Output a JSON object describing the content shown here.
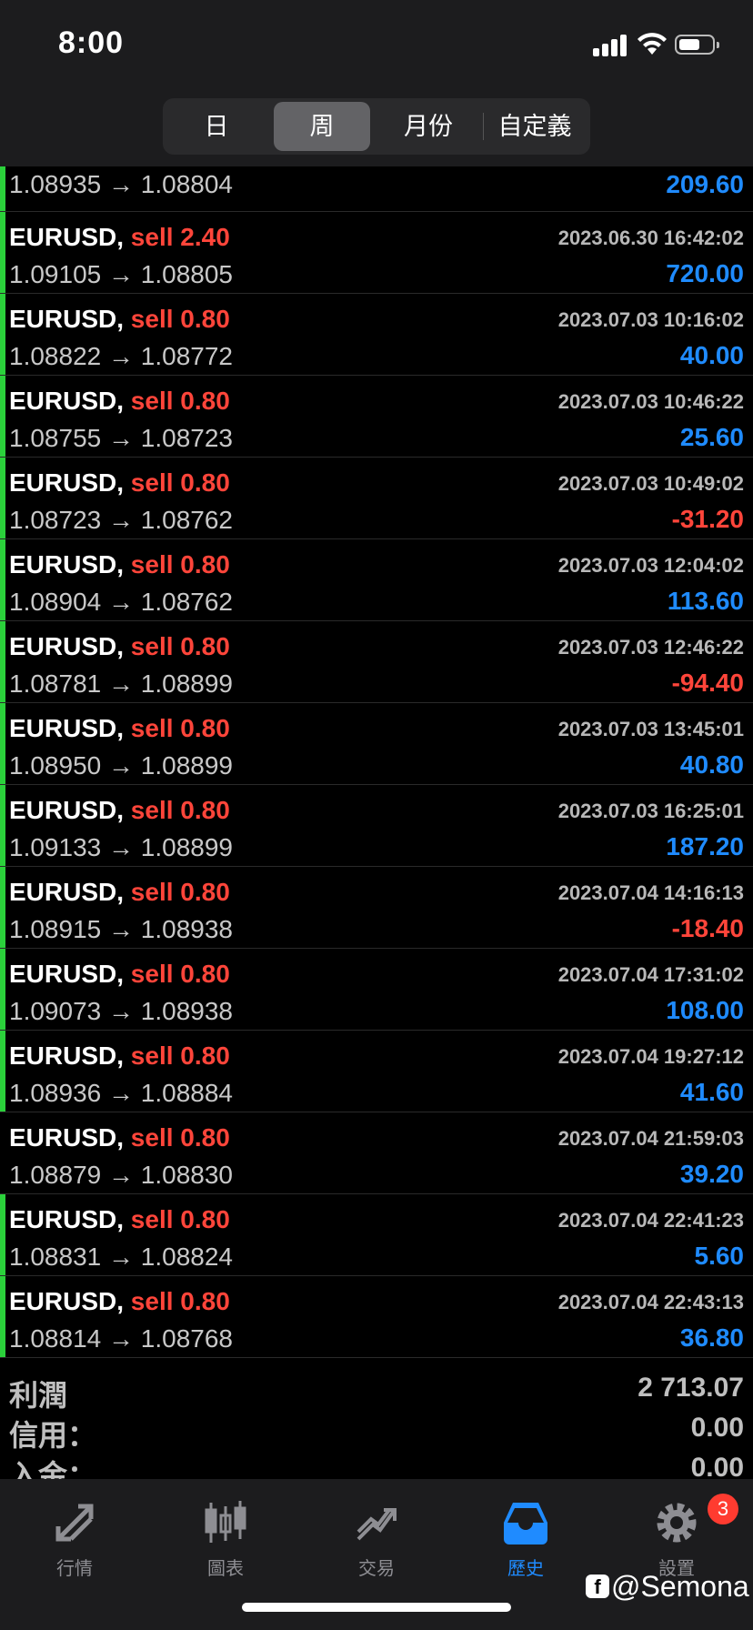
{
  "status": {
    "time": "8:00"
  },
  "segments": [
    "日",
    "周",
    "月份",
    "自定義"
  ],
  "segments_active": "周",
  "partial_row": {
    "price_open": "1.08935",
    "price_close": "1.08804",
    "profit": "209.60"
  },
  "rows": [
    {
      "symbol": "EURUSD",
      "side": "sell",
      "volume": "2.40",
      "datetime": "2023.06.30 16:42:02",
      "price_open": "1.09105",
      "price_close": "1.08805",
      "profit": "720.00",
      "bar": true
    },
    {
      "symbol": "EURUSD",
      "side": "sell",
      "volume": "0.80",
      "datetime": "2023.07.03 10:16:02",
      "price_open": "1.08822",
      "price_close": "1.08772",
      "profit": "40.00",
      "bar": true
    },
    {
      "symbol": "EURUSD",
      "side": "sell",
      "volume": "0.80",
      "datetime": "2023.07.03 10:46:22",
      "price_open": "1.08755",
      "price_close": "1.08723",
      "profit": "25.60",
      "bar": true
    },
    {
      "symbol": "EURUSD",
      "side": "sell",
      "volume": "0.80",
      "datetime": "2023.07.03 10:49:02",
      "price_open": "1.08723",
      "price_close": "1.08762",
      "profit": "-31.20",
      "bar": true
    },
    {
      "symbol": "EURUSD",
      "side": "sell",
      "volume": "0.80",
      "datetime": "2023.07.03 12:04:02",
      "price_open": "1.08904",
      "price_close": "1.08762",
      "profit": "113.60",
      "bar": true
    },
    {
      "symbol": "EURUSD",
      "side": "sell",
      "volume": "0.80",
      "datetime": "2023.07.03 12:46:22",
      "price_open": "1.08781",
      "price_close": "1.08899",
      "profit": "-94.40",
      "bar": true
    },
    {
      "symbol": "EURUSD",
      "side": "sell",
      "volume": "0.80",
      "datetime": "2023.07.03 13:45:01",
      "price_open": "1.08950",
      "price_close": "1.08899",
      "profit": "40.80",
      "bar": true
    },
    {
      "symbol": "EURUSD",
      "side": "sell",
      "volume": "0.80",
      "datetime": "2023.07.03 16:25:01",
      "price_open": "1.09133",
      "price_close": "1.08899",
      "profit": "187.20",
      "bar": true
    },
    {
      "symbol": "EURUSD",
      "side": "sell",
      "volume": "0.80",
      "datetime": "2023.07.04 14:16:13",
      "price_open": "1.08915",
      "price_close": "1.08938",
      "profit": "-18.40",
      "bar": true
    },
    {
      "symbol": "EURUSD",
      "side": "sell",
      "volume": "0.80",
      "datetime": "2023.07.04 17:31:02",
      "price_open": "1.09073",
      "price_close": "1.08938",
      "profit": "108.00",
      "bar": true
    },
    {
      "symbol": "EURUSD",
      "side": "sell",
      "volume": "0.80",
      "datetime": "2023.07.04 19:27:12",
      "price_open": "1.08936",
      "price_close": "1.08884",
      "profit": "41.60",
      "bar": true
    },
    {
      "symbol": "EURUSD",
      "side": "sell",
      "volume": "0.80",
      "datetime": "2023.07.04 21:59:03",
      "price_open": "1.08879",
      "price_close": "1.08830",
      "profit": "39.20",
      "bar": false
    },
    {
      "symbol": "EURUSD",
      "side": "sell",
      "volume": "0.80",
      "datetime": "2023.07.04 22:41:23",
      "price_open": "1.08831",
      "price_close": "1.08824",
      "profit": "5.60",
      "bar": true
    },
    {
      "symbol": "EURUSD",
      "side": "sell",
      "volume": "0.80",
      "datetime": "2023.07.04 22:43:13",
      "price_open": "1.08814",
      "price_close": "1.08768",
      "profit": "36.80",
      "bar": true
    }
  ],
  "summary": {
    "profit_label": "利潤",
    "profit_value": "2 713.07",
    "credit_label": "信用：",
    "credit_value": "0.00",
    "deposit_label": "入金：",
    "deposit_value": "0.00"
  },
  "tabs": [
    {
      "label": "行情",
      "icon": "quotes-icon"
    },
    {
      "label": "圖表",
      "icon": "chart-icon"
    },
    {
      "label": "交易",
      "icon": "trade-icon"
    },
    {
      "label": "歷史",
      "icon": "history-icon",
      "active": true
    },
    {
      "label": "設置",
      "icon": "settings-icon",
      "badge": "3"
    }
  ],
  "watermark": "@Semona",
  "colors": {
    "profit_positive": "#1f8bff",
    "profit_negative": "#ff453a",
    "side_sell": "#ff453a",
    "marker": "#2bd13b",
    "tab_active": "#1f8bff"
  }
}
